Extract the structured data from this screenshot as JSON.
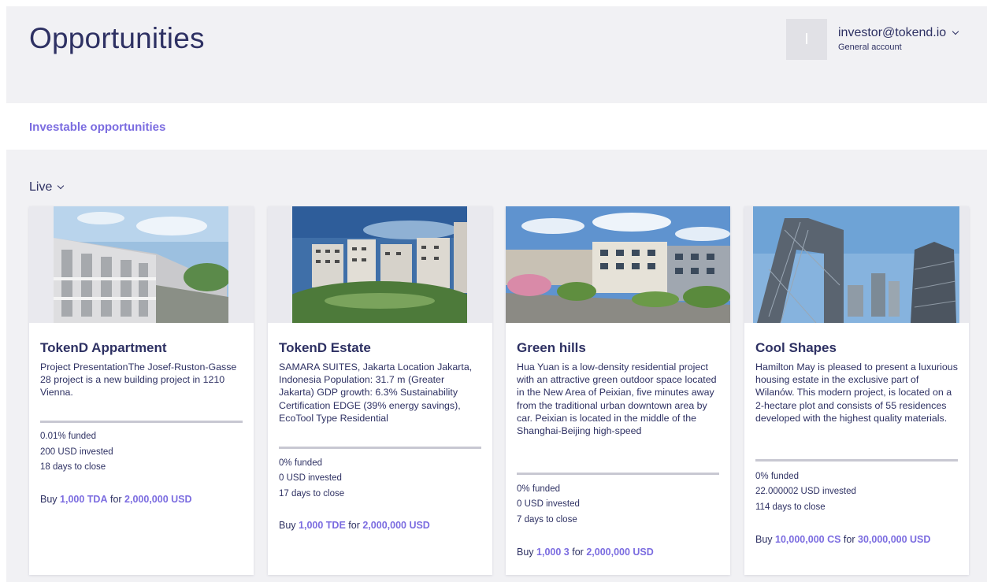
{
  "header": {
    "title": "Opportunities",
    "user": {
      "avatar_letter": "I",
      "email": "investor@tokend.io",
      "account_type": "General account",
      "dropdown_icon": "chevron-down-icon"
    }
  },
  "tabs": {
    "investable": "Investable opportunities"
  },
  "filter": {
    "label": "Live",
    "icon": "chevron-down-icon"
  },
  "colors": {
    "accent": "#7b6ce0",
    "text": "#2e3163",
    "background": "#f1f1f4"
  },
  "cards": [
    {
      "title": "TokenD Appartment",
      "description": "Project PresentationThe Josef-Ruston-Gasse 28 project is a new building project in 1210 Vienna.",
      "funded": "0.01% funded",
      "invested": "200 USD invested",
      "days": "18 days to close",
      "buy_prefix": "Buy",
      "buy_amount": "1,000 TDA",
      "buy_for": "for",
      "buy_price": "2,000,000 USD"
    },
    {
      "title": "TokenD Estate",
      "description": "SAMARA SUITES, Jakarta Location Jakarta, Indonesia Population: 31.7 m (Greater Jakarta) GDP growth: 6.3% Sustainability Certification EDGE (39% energy savings), EcoTool Type Residential",
      "funded": "0% funded",
      "invested": "0 USD invested",
      "days": "17 days to close",
      "buy_prefix": "Buy",
      "buy_amount": "1,000 TDE",
      "buy_for": "for",
      "buy_price": "2,000,000 USD"
    },
    {
      "title": "Green hills",
      "description": "Hua Yuan is a low-density residential project with an attractive green outdoor space located in the New Area of Peixian, five minutes away from the traditional urban downtown area by car. Peixian is located in the middle of the Shanghai-Beijing high-speed",
      "funded": "0% funded",
      "invested": "0 USD invested",
      "days": "7 days to close",
      "buy_prefix": "Buy",
      "buy_amount": "1,000 3",
      "buy_for": "for",
      "buy_price": "2,000,000 USD"
    },
    {
      "title": "Cool Shapes",
      "description": "Hamilton May is pleased to present a luxurious housing estate in the exclusive part of Wilanów. This modern project, is located on a 2-hectare plot and consists of 55 residences developed with the highest quality materials.",
      "funded": "0% funded",
      "invested": "22.000002 USD invested",
      "days": "114 days to close",
      "buy_prefix": "Buy",
      "buy_amount": "10,000,000 CS",
      "buy_for": "for",
      "buy_price": "30,000,000 USD"
    }
  ]
}
